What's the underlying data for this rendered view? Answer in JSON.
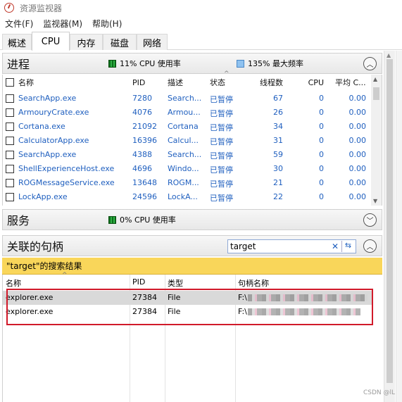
{
  "window": {
    "title": "资源监视器"
  },
  "menu": [
    "文件(F)",
    "监视器(M)",
    "帮助(H)"
  ],
  "tabs": [
    "概述",
    "CPU",
    "内存",
    "磁盘",
    "网络"
  ],
  "active_tab": "CPU",
  "processes": {
    "title": "进程",
    "cpu_usage": "11% CPU 使用率",
    "max_freq": "135% 最大频率",
    "columns": [
      "名称",
      "PID",
      "描述",
      "状态",
      "线程数",
      "CPU",
      "平均 C..."
    ],
    "rows": [
      {
        "name": "SearchApp.exe",
        "pid": "7280",
        "desc": "Search...",
        "status": "已暂停",
        "threads": "67",
        "cpu": "0",
        "avg": "0.00"
      },
      {
        "name": "ArmouryCrate.exe",
        "pid": "4076",
        "desc": "Armou...",
        "status": "已暂停",
        "threads": "26",
        "cpu": "0",
        "avg": "0.00"
      },
      {
        "name": "Cortana.exe",
        "pid": "21092",
        "desc": "Cortana",
        "status": "已暂停",
        "threads": "34",
        "cpu": "0",
        "avg": "0.00"
      },
      {
        "name": "CalculatorApp.exe",
        "pid": "16396",
        "desc": "Calcul...",
        "status": "已暂停",
        "threads": "31",
        "cpu": "0",
        "avg": "0.00"
      },
      {
        "name": "SearchApp.exe",
        "pid": "4388",
        "desc": "Search...",
        "status": "已暂停",
        "threads": "59",
        "cpu": "0",
        "avg": "0.00"
      },
      {
        "name": "ShellExperienceHost.exe",
        "pid": "4696",
        "desc": "Windo...",
        "status": "已暂停",
        "threads": "30",
        "cpu": "0",
        "avg": "0.00"
      },
      {
        "name": "ROGMessageService.exe",
        "pid": "13648",
        "desc": "ROGM...",
        "status": "已暂停",
        "threads": "21",
        "cpu": "0",
        "avg": "0.00"
      },
      {
        "name": "LockApp.exe",
        "pid": "24596",
        "desc": "LockA...",
        "status": "已暂停",
        "threads": "22",
        "cpu": "0",
        "avg": "0.00"
      }
    ]
  },
  "services": {
    "title": "服务",
    "cpu_usage": "0% CPU 使用率"
  },
  "handles": {
    "title": "关联的句柄",
    "search_value": "target",
    "result_label": "\"target\"的搜索结果",
    "columns": [
      "名称",
      "PID",
      "类型",
      "句柄名称"
    ],
    "rows": [
      {
        "name": "explorer.exe",
        "pid": "27384",
        "type": "File",
        "handle": "F:\\"
      },
      {
        "name": "explorer.exe",
        "pid": "27384",
        "type": "File",
        "handle": "F:\\"
      }
    ]
  },
  "watermark": "CSDN @lL",
  "colors": {
    "link": "#1f5fbf",
    "result_bar": "#f9d65a",
    "highlight_box": "#d11a2a",
    "cpu_meter": "#1e8c2a",
    "freq_meter": "#8fc2f0"
  },
  "icons": [
    "resource-monitor-app-icon",
    "chevron-up-icon",
    "chevron-down-icon",
    "sort-up-icon",
    "clear-x-icon",
    "refresh-icon"
  ]
}
